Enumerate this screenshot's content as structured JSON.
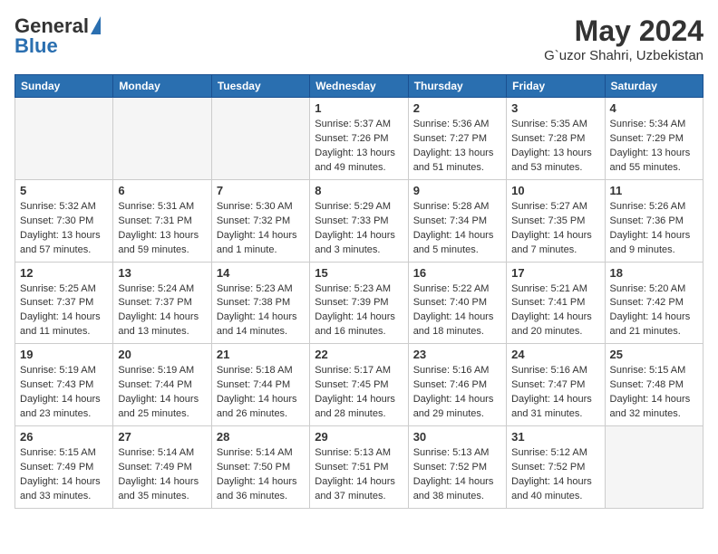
{
  "header": {
    "logo_general": "General",
    "logo_blue": "Blue",
    "month_title": "May 2024",
    "location": "G`uzor Shahri, Uzbekistan"
  },
  "days_of_week": [
    "Sunday",
    "Monday",
    "Tuesday",
    "Wednesday",
    "Thursday",
    "Friday",
    "Saturday"
  ],
  "weeks": [
    [
      {
        "day": "",
        "info": ""
      },
      {
        "day": "",
        "info": ""
      },
      {
        "day": "",
        "info": ""
      },
      {
        "day": "1",
        "sunrise": "5:37 AM",
        "sunset": "7:26 PM",
        "daylight": "13 hours and 49 minutes."
      },
      {
        "day": "2",
        "sunrise": "5:36 AM",
        "sunset": "7:27 PM",
        "daylight": "13 hours and 51 minutes."
      },
      {
        "day": "3",
        "sunrise": "5:35 AM",
        "sunset": "7:28 PM",
        "daylight": "13 hours and 53 minutes."
      },
      {
        "day": "4",
        "sunrise": "5:34 AM",
        "sunset": "7:29 PM",
        "daylight": "13 hours and 55 minutes."
      }
    ],
    [
      {
        "day": "5",
        "sunrise": "5:32 AM",
        "sunset": "7:30 PM",
        "daylight": "13 hours and 57 minutes."
      },
      {
        "day": "6",
        "sunrise": "5:31 AM",
        "sunset": "7:31 PM",
        "daylight": "13 hours and 59 minutes."
      },
      {
        "day": "7",
        "sunrise": "5:30 AM",
        "sunset": "7:32 PM",
        "daylight": "14 hours and 1 minute."
      },
      {
        "day": "8",
        "sunrise": "5:29 AM",
        "sunset": "7:33 PM",
        "daylight": "14 hours and 3 minutes."
      },
      {
        "day": "9",
        "sunrise": "5:28 AM",
        "sunset": "7:34 PM",
        "daylight": "14 hours and 5 minutes."
      },
      {
        "day": "10",
        "sunrise": "5:27 AM",
        "sunset": "7:35 PM",
        "daylight": "14 hours and 7 minutes."
      },
      {
        "day": "11",
        "sunrise": "5:26 AM",
        "sunset": "7:36 PM",
        "daylight": "14 hours and 9 minutes."
      }
    ],
    [
      {
        "day": "12",
        "sunrise": "5:25 AM",
        "sunset": "7:37 PM",
        "daylight": "14 hours and 11 minutes."
      },
      {
        "day": "13",
        "sunrise": "5:24 AM",
        "sunset": "7:37 PM",
        "daylight": "14 hours and 13 minutes."
      },
      {
        "day": "14",
        "sunrise": "5:23 AM",
        "sunset": "7:38 PM",
        "daylight": "14 hours and 14 minutes."
      },
      {
        "day": "15",
        "sunrise": "5:23 AM",
        "sunset": "7:39 PM",
        "daylight": "14 hours and 16 minutes."
      },
      {
        "day": "16",
        "sunrise": "5:22 AM",
        "sunset": "7:40 PM",
        "daylight": "14 hours and 18 minutes."
      },
      {
        "day": "17",
        "sunrise": "5:21 AM",
        "sunset": "7:41 PM",
        "daylight": "14 hours and 20 minutes."
      },
      {
        "day": "18",
        "sunrise": "5:20 AM",
        "sunset": "7:42 PM",
        "daylight": "14 hours and 21 minutes."
      }
    ],
    [
      {
        "day": "19",
        "sunrise": "5:19 AM",
        "sunset": "7:43 PM",
        "daylight": "14 hours and 23 minutes."
      },
      {
        "day": "20",
        "sunrise": "5:19 AM",
        "sunset": "7:44 PM",
        "daylight": "14 hours and 25 minutes."
      },
      {
        "day": "21",
        "sunrise": "5:18 AM",
        "sunset": "7:44 PM",
        "daylight": "14 hours and 26 minutes."
      },
      {
        "day": "22",
        "sunrise": "5:17 AM",
        "sunset": "7:45 PM",
        "daylight": "14 hours and 28 minutes."
      },
      {
        "day": "23",
        "sunrise": "5:16 AM",
        "sunset": "7:46 PM",
        "daylight": "14 hours and 29 minutes."
      },
      {
        "day": "24",
        "sunrise": "5:16 AM",
        "sunset": "7:47 PM",
        "daylight": "14 hours and 31 minutes."
      },
      {
        "day": "25",
        "sunrise": "5:15 AM",
        "sunset": "7:48 PM",
        "daylight": "14 hours and 32 minutes."
      }
    ],
    [
      {
        "day": "26",
        "sunrise": "5:15 AM",
        "sunset": "7:49 PM",
        "daylight": "14 hours and 33 minutes."
      },
      {
        "day": "27",
        "sunrise": "5:14 AM",
        "sunset": "7:49 PM",
        "daylight": "14 hours and 35 minutes."
      },
      {
        "day": "28",
        "sunrise": "5:14 AM",
        "sunset": "7:50 PM",
        "daylight": "14 hours and 36 minutes."
      },
      {
        "day": "29",
        "sunrise": "5:13 AM",
        "sunset": "7:51 PM",
        "daylight": "14 hours and 37 minutes."
      },
      {
        "day": "30",
        "sunrise": "5:13 AM",
        "sunset": "7:52 PM",
        "daylight": "14 hours and 38 minutes."
      },
      {
        "day": "31",
        "sunrise": "5:12 AM",
        "sunset": "7:52 PM",
        "daylight": "14 hours and 40 minutes."
      },
      {
        "day": "",
        "info": ""
      }
    ]
  ]
}
